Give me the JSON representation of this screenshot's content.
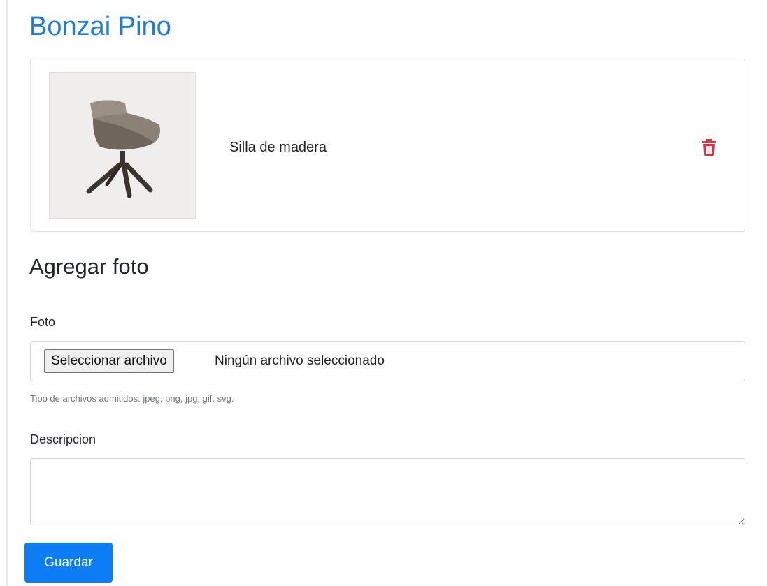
{
  "product": {
    "title": "Bonzai Pino"
  },
  "photos": [
    {
      "description": "Silla de madera",
      "image_icon": "chair-photo",
      "delete_icon": "trash-icon"
    }
  ],
  "form": {
    "heading": "Agregar foto",
    "photo_label": "Foto",
    "file_button_label": "Seleccionar archivo",
    "file_status": "Ningún archivo seleccionado",
    "file_help": "Tipo de archivos admitidos: jpeg, png, jpg, gif, svg.",
    "description_label": "Descripcion",
    "description_value": "",
    "submit_label": "Guardar"
  },
  "colors": {
    "title": "#1e7bdc",
    "primary_button": "#0d7df5",
    "danger_icon": "#dc3545"
  }
}
